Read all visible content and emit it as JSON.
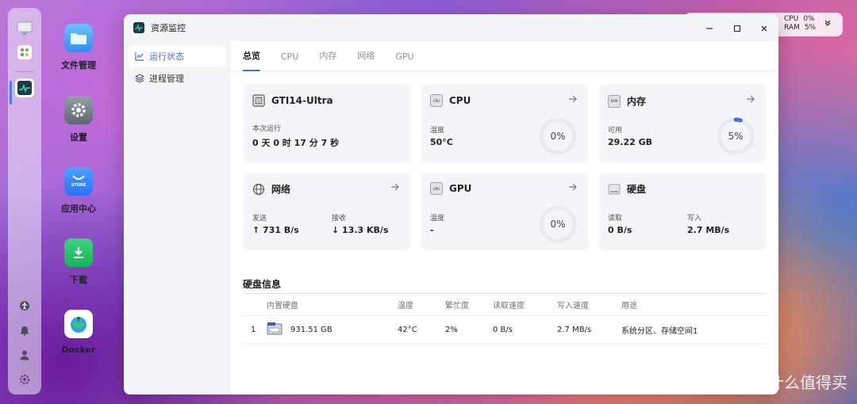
{
  "desktop": {
    "icons": [
      {
        "label": "文件管理"
      },
      {
        "label": "设置"
      },
      {
        "label": "应用中心",
        "badge": "STORE"
      },
      {
        "label": "下载"
      },
      {
        "label": "Docker"
      }
    ]
  },
  "widget": {
    "cpu_label": "CPU",
    "cpu_value": "0%",
    "ram_label": "RAM",
    "ram_value": "5%"
  },
  "window": {
    "title": "资源监控",
    "sidebar": [
      {
        "label": "运行状态",
        "active": true
      },
      {
        "label": "进程管理",
        "active": false
      }
    ],
    "tabs": [
      "总览",
      "CPU",
      "内存",
      "网络",
      "GPU"
    ],
    "cards": {
      "device": {
        "title": "GTI14-Ultra",
        "uptime_label": "本次运行",
        "uptime_value": "0 天 0 时 17 分 7 秒"
      },
      "cpu": {
        "title": "CPU",
        "temp_label": "温度",
        "temp_value": "50°C",
        "usage": "0%",
        "usage_fraction": 0
      },
      "memory": {
        "title": "内存",
        "avail_label": "可用",
        "avail_value": "29.22 GB",
        "usage": "5%",
        "usage_fraction": 0.05
      },
      "network": {
        "title": "网络",
        "send_label": "发送",
        "send_value": "↑ 731 B/s",
        "recv_label": "接收",
        "recv_value": "↓ 13.3 KB/s"
      },
      "gpu": {
        "title": "GPU",
        "temp_label": "温度",
        "temp_value": "-",
        "usage": "0%",
        "usage_fraction": 0
      },
      "disk": {
        "title": "硬盘",
        "read_label": "读取",
        "read_value": "0 B/s",
        "write_label": "写入",
        "write_value": "2.7 MB/s"
      }
    },
    "disk_info": {
      "title": "硬盘信息",
      "columns": [
        "内置硬盘",
        "温度",
        "繁忙度",
        "读取速度",
        "写入速度",
        "用途"
      ],
      "rows": [
        {
          "index": "1",
          "size": "931.51 GB",
          "temp": "42°C",
          "busy": "2%",
          "read": "0 B/s",
          "write": "2.7 MB/s",
          "usage": "系统分区、存储空间1"
        }
      ]
    }
  },
  "watermark": {
    "text": "什么值得买",
    "mark": "值"
  },
  "colors": {
    "accent": "#3f6fe0",
    "ring_track": "#e8eaee",
    "memory_ring": "#4a6cf7"
  }
}
